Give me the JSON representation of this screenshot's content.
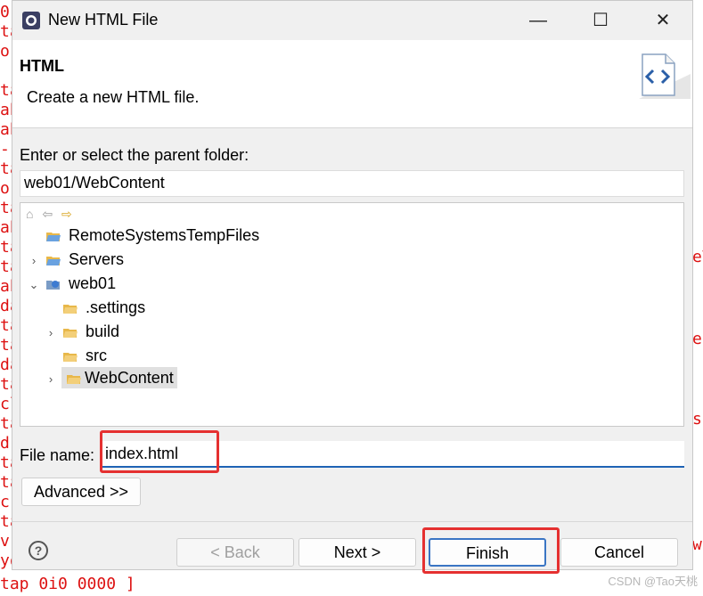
{
  "background_console": {
    "left_fragments": [
      "0",
      "ta",
      "o",
      "",
      "ta",
      "ab",
      "ab",
      "-",
      "ta",
      "or",
      "ta",
      "ab",
      "ta",
      "ta",
      "ab",
      "da",
      "ta",
      "ta",
      "da",
      "ta",
      "cl",
      "ta",
      "d",
      "ta",
      "ta",
      "c",
      "ta",
      "v",
      "yo"
    ],
    "right_fragments": [
      "eV",
      "e.",
      "st",
      "w"
    ],
    "bottom_text": "tap 0i0 0000 ]"
  },
  "watermark": "CSDN @Tao天桃",
  "window": {
    "title": "New HTML File",
    "min_glyph": "—",
    "max_glyph": "☐",
    "close_glyph": "✕"
  },
  "header": {
    "title": "HTML",
    "description": "Create a new HTML file."
  },
  "folder": {
    "label": "Enter or select the parent folder:",
    "value": "web01/WebContent"
  },
  "tree": {
    "toolbar": [
      "home-icon",
      "back-arrow-icon",
      "forward-arrow-icon"
    ],
    "items": [
      {
        "label": "RemoteSystemsTempFiles",
        "twisty": ""
      },
      {
        "label": "Servers",
        "twisty": "›"
      },
      {
        "label": "web01",
        "twisty": "⌄"
      },
      {
        "label": ".settings",
        "twisty": ""
      },
      {
        "label": "build",
        "twisty": "›"
      },
      {
        "label": "src",
        "twisty": ""
      },
      {
        "label": "WebContent",
        "twisty": "›"
      }
    ]
  },
  "file_name": {
    "label": "File name:",
    "value": "index.html"
  },
  "buttons": {
    "advanced": "Advanced >>",
    "back": "< Back",
    "next": "Next >",
    "finish": "Finish",
    "cancel": "Cancel",
    "help": "?"
  },
  "colors": {
    "accent": "#1e63b5",
    "highlight_box": "#e53030",
    "folder_icon": "#e8b84a"
  }
}
